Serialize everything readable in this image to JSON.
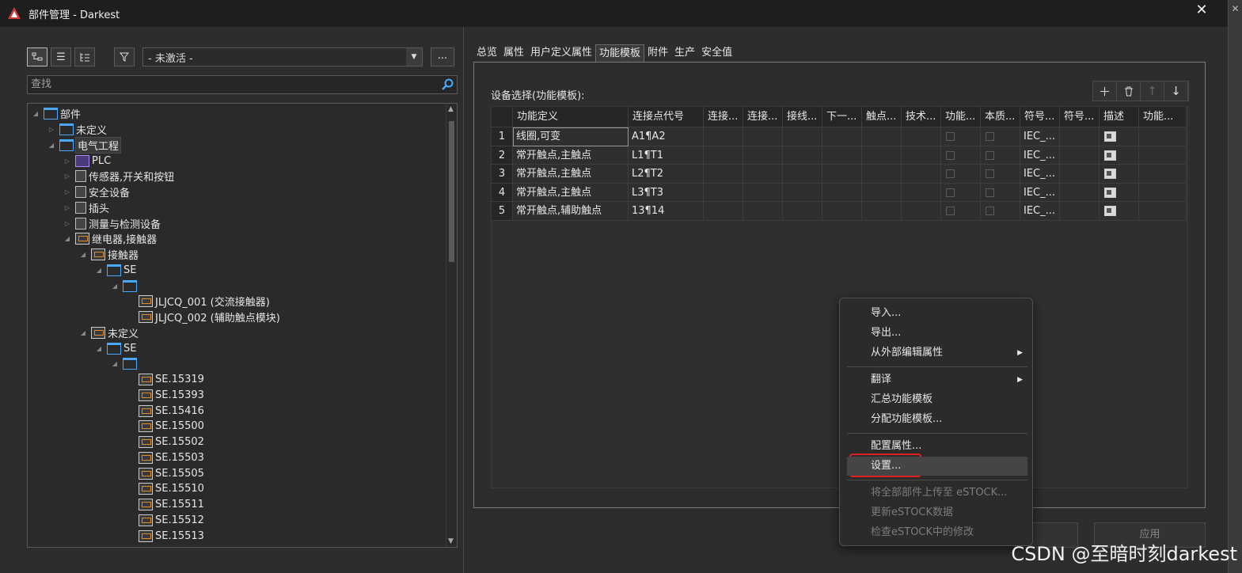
{
  "window": {
    "title": "部件管理 - Darkest",
    "close_glyph": "✕"
  },
  "left": {
    "filter_value": "- 未激活 -",
    "more_label": "...",
    "search_placeholder": "查找",
    "tree": [
      {
        "label": "部件",
        "depth": 0,
        "icon": "folder-icon",
        "twisty": "◢"
      },
      {
        "label": "未定义",
        "depth": 1,
        "icon": "folder-icon",
        "twisty": "▷"
      },
      {
        "label": "电气工程",
        "depth": 1,
        "icon": "folder-icon",
        "twisty": "◢",
        "selected": true
      },
      {
        "label": "PLC",
        "depth": 2,
        "icon": "plc-icon",
        "twisty": "▷"
      },
      {
        "label": "传感器,开关和按钮",
        "depth": 2,
        "icon": "sensor-icon",
        "twisty": "▷"
      },
      {
        "label": "安全设备",
        "depth": 2,
        "icon": "safety-icon",
        "twisty": "▷"
      },
      {
        "label": "插头",
        "depth": 2,
        "icon": "plug-icon",
        "twisty": "▷"
      },
      {
        "label": "测量与检测设备",
        "depth": 2,
        "icon": "meter-icon",
        "twisty": "▷"
      },
      {
        "label": "继电器,接触器",
        "depth": 2,
        "icon": "device-icon",
        "twisty": "◢"
      },
      {
        "label": "接触器",
        "depth": 3,
        "icon": "device-icon",
        "twisty": "◢"
      },
      {
        "label": "SE",
        "depth": 4,
        "icon": "folder-icon",
        "twisty": "◢"
      },
      {
        "label": "",
        "depth": 5,
        "icon": "folder-icon",
        "twisty": "◢"
      },
      {
        "label": "JLJCQ_001 (交流接触器)",
        "depth": 6,
        "icon": "device-icon",
        "twisty": ""
      },
      {
        "label": "JLJCQ_002 (辅助触点模块)",
        "depth": 6,
        "icon": "device-icon",
        "twisty": ""
      },
      {
        "label": "未定义",
        "depth": 3,
        "icon": "device-icon",
        "twisty": "◢"
      },
      {
        "label": "SE",
        "depth": 4,
        "icon": "folder-icon",
        "twisty": "◢"
      },
      {
        "label": "",
        "depth": 5,
        "icon": "folder-icon",
        "twisty": "◢"
      },
      {
        "label": "SE.15319",
        "depth": 6,
        "icon": "device-icon",
        "twisty": ""
      },
      {
        "label": "SE.15393",
        "depth": 6,
        "icon": "device-icon",
        "twisty": ""
      },
      {
        "label": "SE.15416",
        "depth": 6,
        "icon": "device-icon",
        "twisty": ""
      },
      {
        "label": "SE.15500",
        "depth": 6,
        "icon": "device-icon",
        "twisty": ""
      },
      {
        "label": "SE.15502",
        "depth": 6,
        "icon": "device-icon",
        "twisty": ""
      },
      {
        "label": "SE.15503",
        "depth": 6,
        "icon": "device-icon",
        "twisty": ""
      },
      {
        "label": "SE.15505",
        "depth": 6,
        "icon": "device-icon",
        "twisty": ""
      },
      {
        "label": "SE.15510",
        "depth": 6,
        "icon": "device-icon",
        "twisty": ""
      },
      {
        "label": "SE.15511",
        "depth": 6,
        "icon": "device-icon",
        "twisty": ""
      },
      {
        "label": "SE.15512",
        "depth": 6,
        "icon": "device-icon",
        "twisty": ""
      },
      {
        "label": "SE.15513",
        "depth": 6,
        "icon": "device-icon",
        "twisty": ""
      }
    ]
  },
  "tabs": [
    "总览",
    "属性",
    "用户定义属性",
    "功能模板",
    "附件",
    "生产",
    "安全值"
  ],
  "active_tab": 3,
  "equip_label": "设备选择(功能模板):",
  "grid_buttons": [
    "＋",
    "🗑",
    "↑",
    "↓"
  ],
  "grid": {
    "headers": [
      "功能定义",
      "连接点代号",
      "连接...",
      "连接...",
      "接线...",
      "下一...",
      "触点...",
      "技术...",
      "功能...",
      "本质...",
      "符号...",
      "符号...",
      "描述",
      "功能..."
    ],
    "rows": [
      {
        "num": "1",
        "func": "线圈,可变",
        "conn": "A1¶A2",
        "sym": "IEC_..."
      },
      {
        "num": "2",
        "func": "常开触点,主触点",
        "conn": "L1¶T1",
        "sym": "IEC_..."
      },
      {
        "num": "3",
        "func": "常开触点,主触点",
        "conn": "L2¶T2",
        "sym": "IEC_..."
      },
      {
        "num": "4",
        "func": "常开触点,主触点",
        "conn": "L3¶T3",
        "sym": "IEC_..."
      },
      {
        "num": "5",
        "func": "常开触点,辅助触点",
        "conn": "13¶14",
        "sym": "IEC_..."
      }
    ]
  },
  "bottom_buttons": [
    "",
    "应用"
  ],
  "context_menu": [
    {
      "label": "导入...",
      "enabled": true
    },
    {
      "label": "导出...",
      "enabled": true
    },
    {
      "label": "从外部编辑属性",
      "enabled": true,
      "submenu": true
    },
    {
      "sep": true
    },
    {
      "label": "翻译",
      "enabled": true,
      "submenu": true
    },
    {
      "label": "汇总功能模板",
      "enabled": true
    },
    {
      "label": "分配功能模板...",
      "enabled": true
    },
    {
      "sep": true
    },
    {
      "label": "配置属性...",
      "enabled": true
    },
    {
      "label": "设置...",
      "enabled": true,
      "highlighted": true
    },
    {
      "sep": true
    },
    {
      "label": "将全部部件上传至 eSTOCK...",
      "enabled": false
    },
    {
      "label": "更新eSTOCK数据",
      "enabled": false
    },
    {
      "label": "检查eSTOCK中的修改",
      "enabled": false
    }
  ],
  "watermark": "CSDN @至暗时刻darkest",
  "colors": {
    "accent_red": "#e02020",
    "folder_blue": "#4aa8ff"
  }
}
